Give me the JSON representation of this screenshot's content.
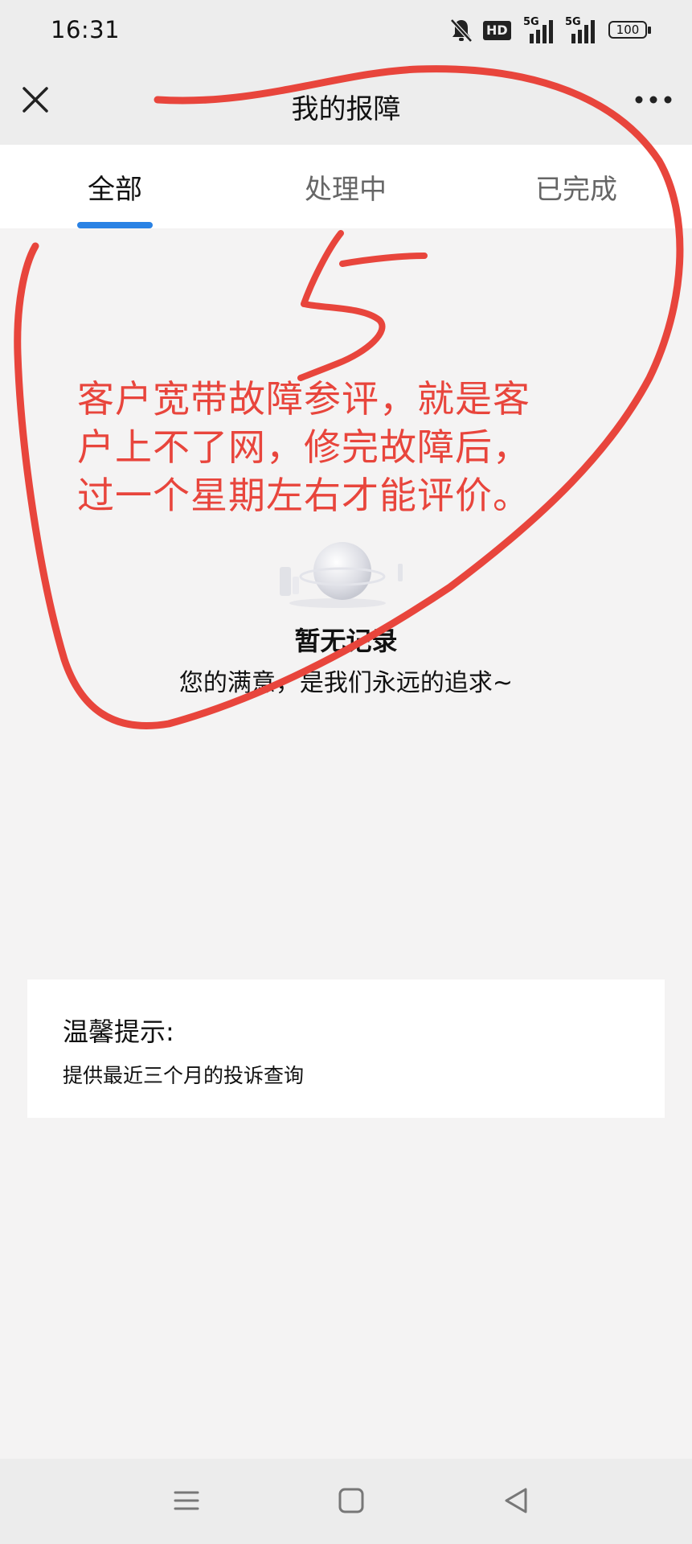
{
  "status_bar": {
    "time": "16:31",
    "hd_badge": "HD",
    "signal_1": "5G",
    "signal_2": "5G",
    "battery": "100",
    "icons": [
      "mute-bell-icon",
      "hd-icon",
      "signal-5g-icon",
      "signal-5g-icon",
      "battery-icon"
    ]
  },
  "header": {
    "title": "我的报障",
    "close_icon": "close-icon",
    "more_icon": "more-dots-icon"
  },
  "tabs": [
    {
      "label": "全部",
      "active": true
    },
    {
      "label": "处理中",
      "active": false
    },
    {
      "label": "已完成",
      "active": false
    }
  ],
  "empty_state": {
    "title": "暂无记录",
    "subtitle": "您的满意，是我们永远的追求~"
  },
  "tip": {
    "title": "温馨提示:",
    "text": "提供最近三个月的投诉查询"
  },
  "annotation": {
    "number": "5",
    "lines": [
      "客户宽带故障参评，就是客",
      "户上不了网，修完故障后，",
      "过一个星期左右才能评价。"
    ],
    "color": "#e8453c"
  },
  "colors": {
    "accent": "#2a82e4",
    "background": "#f4f3f3"
  },
  "nav_bar": {
    "icons": [
      "menu-icon",
      "home-square-icon",
      "back-triangle-icon"
    ]
  }
}
